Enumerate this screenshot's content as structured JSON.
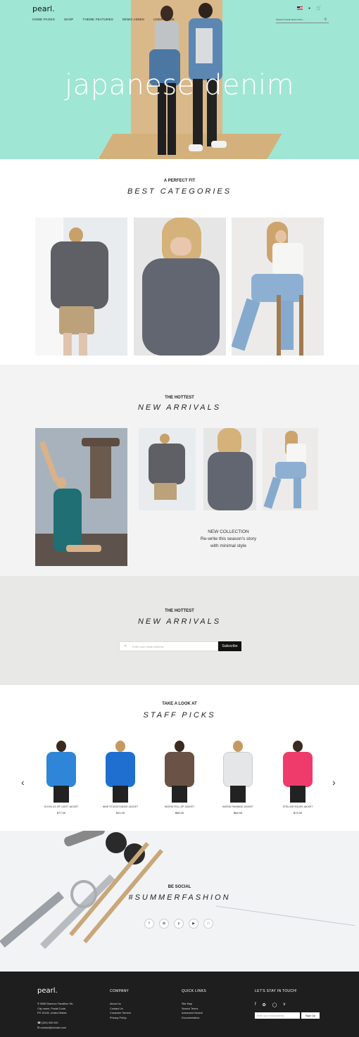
{
  "header": {
    "brand": "pearl.",
    "nav": [
      "HOME PAGES",
      "SHOP",
      "THEME FEATURES",
      "DEMO ADMIN",
      "USER GUIDE"
    ],
    "search_placeholder": "Search entire store here...",
    "icons": [
      "flag-us-icon",
      "user-icon",
      "cart-icon",
      "search-icon"
    ]
  },
  "hero": {
    "title": "japanese denim"
  },
  "categories": {
    "kicker": "A PERFECT FIT",
    "title": "BEST CATEGORIES"
  },
  "arrivals": {
    "kicker": "THE HOTTEST",
    "title": "NEW ARRIVALS",
    "collection_heading": "NEW COLLECTION",
    "collection_line1": "Re-write this season's story",
    "collection_line2": "with minimal style"
  },
  "newsletter": {
    "kicker": "THE HOTTEST",
    "title": "NEW ARRIVALS",
    "placeholder": "Enter your email address",
    "button": "Subscribe"
  },
  "staff": {
    "kicker": "TAKE A LOOK AT",
    "title": "STAFF PICKS",
    "products": [
      {
        "name": "OLIVIA 1/4 ZIP LIGHT JACKET",
        "price": "$77.00",
        "color": "#2f86d8"
      },
      {
        "name": "NINE STUDIO DANCE JACKET",
        "price": "$11.00",
        "color": "#1e6fcf"
      },
      {
        "name": "INGRID FELL ZIP JACKET",
        "price": "$86.00",
        "color": "#6a5246"
      },
      {
        "name": "INGRID RUNNING JACKET",
        "price": "$66.00",
        "color": "#e4e6e8"
      },
      {
        "name": "STELLAR SOLAR JACKET",
        "price": "$73.00",
        "color": "#ef3b6b"
      }
    ]
  },
  "social": {
    "kicker": "BE SOCIAL",
    "title": "#SUMMERFASHION",
    "icons": [
      "facebook-icon",
      "twitter-icon",
      "pinterest-icon",
      "youtube-icon",
      "chat-icon"
    ]
  },
  "footer": {
    "brand": "pearl.",
    "address1": "9065 Brannon Faudition Str.,",
    "address2": "City name, Postal Code,",
    "address3": "FR 19130, United States",
    "phone": "(100) 000 000",
    "email": "contact@domain.com",
    "company_heading": "COMPANY",
    "company_links": [
      "About Us",
      "Contact Us",
      "Customer Service",
      "Privacy Policy"
    ],
    "quick_heading": "QUICK LINKS",
    "quick_links": [
      "Site Map",
      "Search Terms",
      "Advanced Search",
      "Documentation"
    ],
    "stay_heading": "LET'S STAY IN TOUCH!",
    "stay_placeholder": "Enter your email address",
    "stay_button": "Sign Up"
  }
}
